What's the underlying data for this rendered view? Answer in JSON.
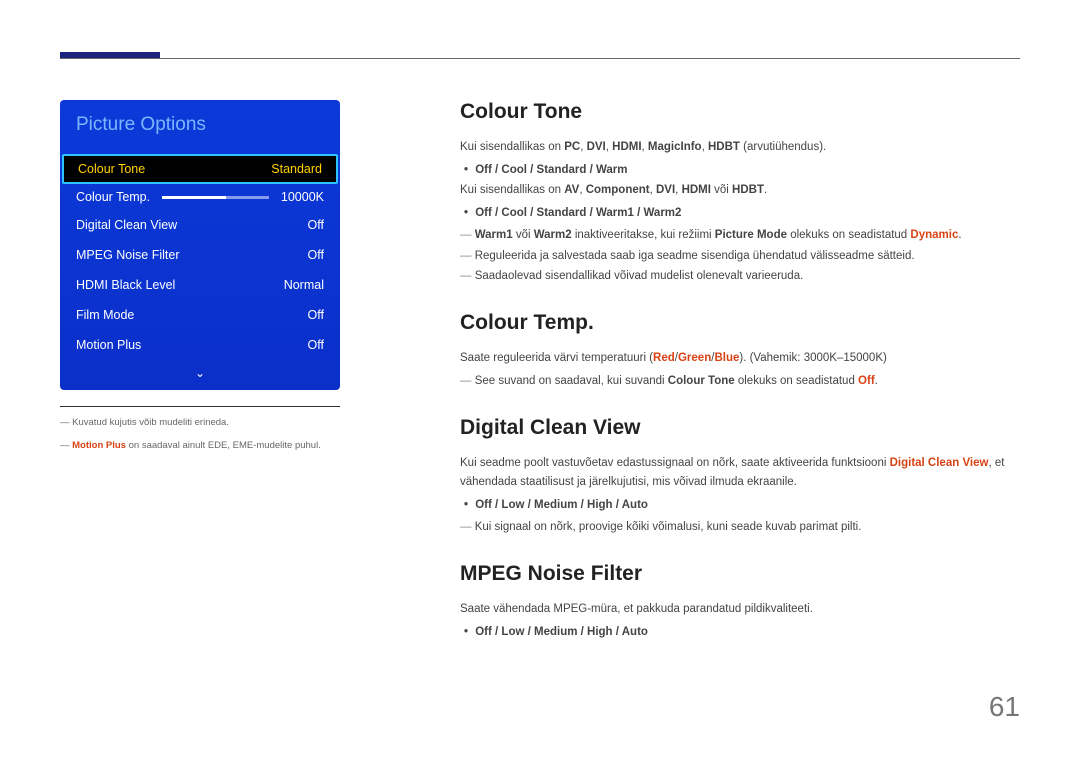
{
  "menu": {
    "title": "Picture Options",
    "rows": [
      {
        "label": "Colour Tone",
        "value": "Standard",
        "selected": true
      },
      {
        "label": "Colour Temp.",
        "value": "10000K",
        "slider": true
      },
      {
        "label": "Digital Clean View",
        "value": "Off"
      },
      {
        "label": "MPEG Noise Filter",
        "value": "Off"
      },
      {
        "label": "HDMI Black Level",
        "value": "Normal"
      },
      {
        "label": "Film Mode",
        "value": "Off"
      },
      {
        "label": "Motion Plus",
        "value": "Off"
      }
    ],
    "arrow": "⌄"
  },
  "footnotes": {
    "f1": "Kuvatud kujutis võib mudeliti erineda.",
    "f2a": "Motion Plus",
    "f2b": " on saadaval ainult EDE, EME-mudelite puhul."
  },
  "sections": {
    "s1": {
      "title": "Colour Tone",
      "p1a": "Kui sisendallikas on ",
      "p1b_pc": "PC",
      "p1b_c1": ", ",
      "p1b_dvi": "DVI",
      "p1b_c2": ", ",
      "p1b_hdmi": "HDMI",
      "p1b_c3": ", ",
      "p1b_mi": "MagicInfo",
      "p1b_c4": ", ",
      "p1b_hdbt": "HDBT",
      "p1c": " (arvutiühendus).",
      "b1": "Off / Cool / Standard / Warm",
      "p2a": "Kui sisendallikas on ",
      "p2b_av": "AV",
      "p2b_c1": ", ",
      "p2b_comp": "Component",
      "p2b_c2": ", ",
      "p2b_dvi": "DVI",
      "p2b_c3": ", ",
      "p2b_hdmi": "HDMI",
      "p2b_c4": " või ",
      "p2b_hdbt": "HDBT",
      "p2c": ".",
      "b2": "Off / Cool / Standard / Warm1 / Warm2",
      "d1a": "Warm1",
      "d1b": " või ",
      "d1c": "Warm2",
      "d1d": " inaktiveeritakse, kui režiimi ",
      "d1e": "Picture Mode",
      "d1f": " olekuks on seadistatud ",
      "d1g": "Dynamic",
      "d1h": ".",
      "d2": "Reguleerida ja salvestada saab iga seadme sisendiga ühendatud välisseadme sätteid.",
      "d3": "Saadaolevad sisendallikad võivad mudelist olenevalt varieeruda."
    },
    "s2": {
      "title": "Colour Temp.",
      "p1a": "Saate reguleerida värvi temperatuuri (",
      "p1b_r": "Red",
      "p1b_s1": "/",
      "p1b_g": "Green",
      "p1b_s2": "/",
      "p1b_b": "Blue",
      "p1c": "). (Vahemik: 3000K–15000K)",
      "d1a": "See suvand on saadaval, kui suvandi ",
      "d1b": "Colour Tone",
      "d1c": " olekuks on seadistatud ",
      "d1d": "Off",
      "d1e": "."
    },
    "s3": {
      "title": "Digital Clean View",
      "p1a": "Kui seadme poolt vastuvõetav edastussignaal on nõrk, saate aktiveerida funktsiooni ",
      "p1b": "Digital Clean View",
      "p1c": ", et vähendada staatilisust ja järelkujutisi, mis võivad ilmuda ekraanile.",
      "b1": "Off / Low / Medium / High / Auto",
      "d1": "Kui signaal on nõrk, proovige kõiki võimalusi, kuni seade kuvab parimat pilti."
    },
    "s4": {
      "title": "MPEG Noise Filter",
      "p1": "Saate vähendada MPEG-müra, et pakkuda parandatud pildikvaliteeti.",
      "b1": "Off / Low / Medium / High / Auto"
    }
  },
  "pageNumber": "61"
}
